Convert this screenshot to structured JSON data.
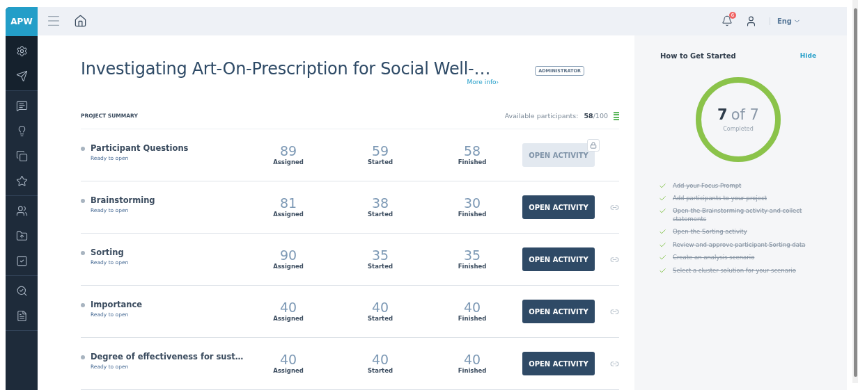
{
  "brand": "APW",
  "topbar": {
    "notifications": "6",
    "language": "Eng"
  },
  "project": {
    "title": "Investigating Art-On-Prescription for Social Well-…",
    "more_info": "More info›",
    "role": "ADMINISTRATOR"
  },
  "summary": {
    "heading": "PROJECT SUMMARY",
    "available_label": "Available participants:",
    "available": "58",
    "total": "/100"
  },
  "activities": [
    {
      "name": "Participant Questions",
      "status": "Ready to open",
      "stats": [
        {
          "value": "89",
          "label": "Assigned"
        },
        {
          "value": "59",
          "label": "Started"
        },
        {
          "value": "58",
          "label": "Finished"
        }
      ],
      "button": "OPEN ACTIVITY",
      "disabled": true,
      "locked": true
    },
    {
      "name": "Brainstorming",
      "status": "Ready to open",
      "stats": [
        {
          "value": "81",
          "label": "Assigned"
        },
        {
          "value": "38",
          "label": "Started"
        },
        {
          "value": "30",
          "label": "Finished"
        }
      ],
      "button": "OPEN ACTIVITY",
      "disabled": false,
      "locked": false
    },
    {
      "name": "Sorting",
      "status": "Ready to open",
      "stats": [
        {
          "value": "90",
          "label": "Assigned"
        },
        {
          "value": "35",
          "label": "Started"
        },
        {
          "value": "35",
          "label": "Finished"
        }
      ],
      "button": "OPEN ACTIVITY",
      "disabled": false,
      "locked": false
    },
    {
      "name": "Importance",
      "status": "Ready to open",
      "stats": [
        {
          "value": "40",
          "label": "Assigned"
        },
        {
          "value": "40",
          "label": "Started"
        },
        {
          "value": "40",
          "label": "Finished"
        }
      ],
      "button": "OPEN ACTIVITY",
      "disabled": false,
      "locked": false
    },
    {
      "name": "Degree of effectiveness for sust…",
      "status": "Ready to open",
      "stats": [
        {
          "value": "40",
          "label": "Assigned"
        },
        {
          "value": "40",
          "label": "Started"
        },
        {
          "value": "40",
          "label": "Finished"
        }
      ],
      "button": "OPEN ACTIVITY",
      "disabled": false,
      "locked": false
    }
  ],
  "get_started": {
    "title": "How to Get Started",
    "hide": "Hide",
    "done_count": "7",
    "of_total": "of 7",
    "caption": "Completed",
    "level": 1,
    "steps": [
      {
        "text": "Add your Focus Prompt",
        "done": true
      },
      {
        "text": "Add participants to your project",
        "done": true
      },
      {
        "text": "Open the Brainstorming activity and collect statements",
        "done": true
      },
      {
        "text": "Open the Sorting activity",
        "done": true
      },
      {
        "text": "Review and approve participant Sorting data",
        "done": true
      },
      {
        "text": "Create an analysis scenario",
        "done": true
      },
      {
        "text": "Select a cluster solution for your scenario",
        "done": true
      }
    ]
  }
}
